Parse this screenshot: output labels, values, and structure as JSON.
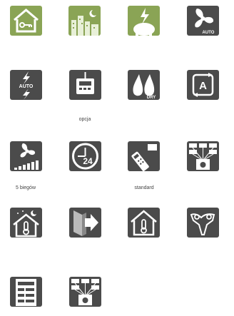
{
  "colors": {
    "green": "#8aa455",
    "dark": "#4b4b4b",
    "white": "#ffffff"
  },
  "icons": [
    {
      "name": "home-key-icon"
    },
    {
      "name": "night-city-icon"
    },
    {
      "name": "power-piggy-bank-icon"
    },
    {
      "name": "fan-auto-icon",
      "badge": "AUTO"
    },
    {
      "name": "auto-restart-icon",
      "badge": "AUTO"
    },
    {
      "name": "wired-controller-icon",
      "caption": "opcja"
    },
    {
      "name": "dry-mode-icon",
      "badge": "DRY"
    },
    {
      "name": "auto-mode-icon",
      "letter": "A"
    },
    {
      "name": "fan-speeds-icon",
      "caption": "5 biegów"
    },
    {
      "name": "timer-24h-icon",
      "number": "24"
    },
    {
      "name": "remote-control-icon",
      "caption": "standard"
    },
    {
      "name": "central-control-icon"
    },
    {
      "name": "night-home-thermometer-icon"
    },
    {
      "name": "wall-airflow-icon"
    },
    {
      "name": "home-thermometer-icon"
    },
    {
      "name": "comfort-people-icon"
    },
    {
      "name": "control-panel-list-icon"
    },
    {
      "name": "network-control-icon"
    }
  ]
}
